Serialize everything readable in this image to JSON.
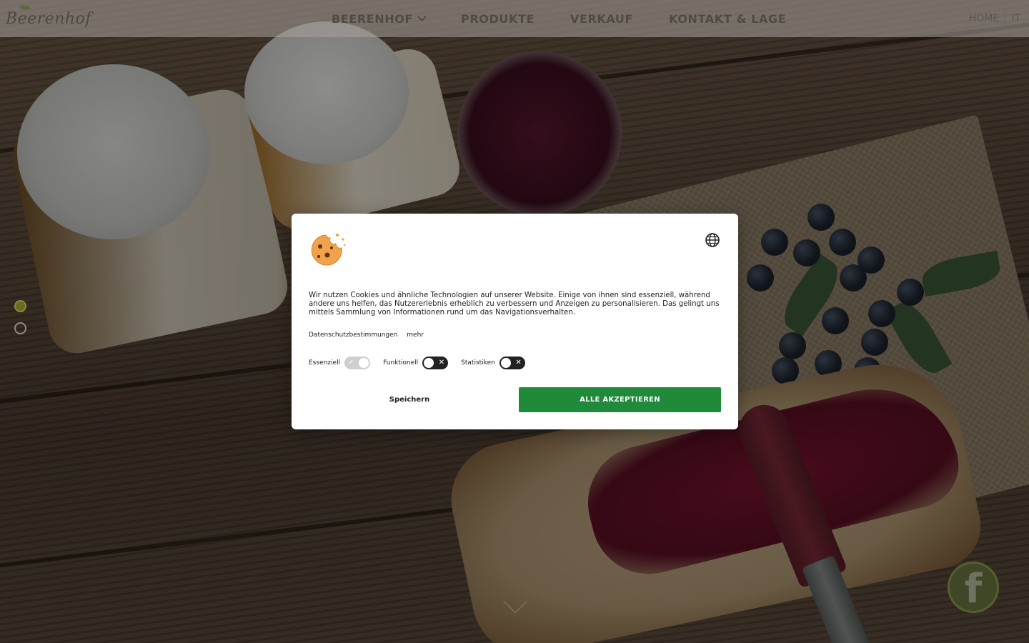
{
  "header": {
    "logo_text": "Beerenhof",
    "nav": [
      {
        "label": "BEERENHOF",
        "has_dropdown": true
      },
      {
        "label": "PRODUKTE",
        "has_dropdown": false
      },
      {
        "label": "VERKAUF",
        "has_dropdown": false
      },
      {
        "label": "KONTAKT & LAGE",
        "has_dropdown": false
      }
    ],
    "home_label": "HOME",
    "language_label": "IT"
  },
  "slider": {
    "slide_count": 2,
    "active_index": 0
  },
  "cookie_dialog": {
    "text": "Wir nutzen Cookies und ähnliche Technologien auf unserer Website. Einige von ihnen sind essenziell, während andere uns helfen, das Nutzererlebnis erheblich zu verbessern und Anzeigen zu personalisieren. Das gelingt uns mittels Sammlung von Informationen rund um das Navigationsverhalten.",
    "privacy_link": "Datenschutzbestimmungen",
    "more_link": "mehr",
    "toggles": [
      {
        "label": "Essenziell",
        "state": "on",
        "disabled": true
      },
      {
        "label": "Funktionell",
        "state": "off",
        "disabled": false
      },
      {
        "label": "Statistiken",
        "state": "off",
        "disabled": false
      }
    ],
    "save_label": "Speichern",
    "accept_label": "ALLE AKZEPTIEREN"
  },
  "colors": {
    "accept_button": "#1e8a3a",
    "active_dot": "#6c6a1c",
    "facebook_button": "#3f4726"
  },
  "icons": {
    "cookie": "cookie-icon",
    "language": "globe-icon",
    "social": "facebook-icon",
    "scroll": "chevron-down-icon"
  },
  "social": {
    "facebook_glyph": "f"
  }
}
